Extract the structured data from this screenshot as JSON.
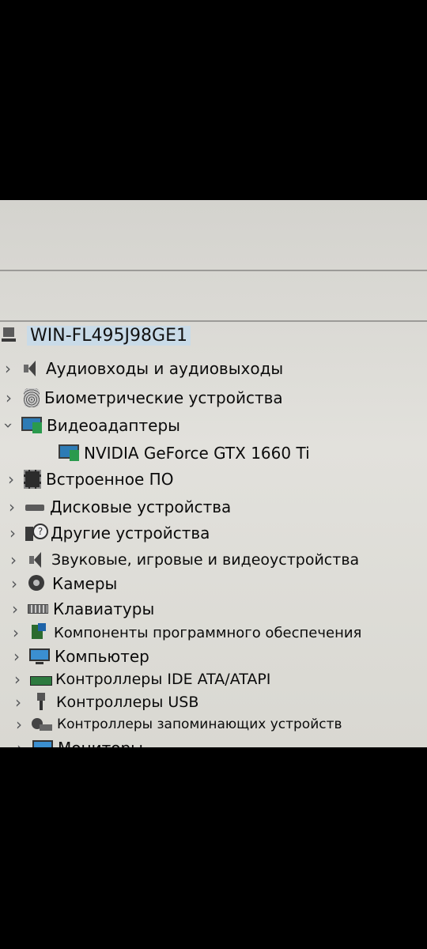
{
  "device_tree": {
    "root": {
      "label": "WIN-FL495J98GE1",
      "icon": "computer-icon"
    },
    "categories": [
      {
        "label": "Аудиовходы и аудиовыходы",
        "icon": "speaker-icon",
        "expanded": false
      },
      {
        "label": "Биометрические устройства",
        "icon": "fingerprint-icon",
        "expanded": false
      },
      {
        "label": "Видеоадаптеры",
        "icon": "display-adapter-icon",
        "expanded": true,
        "children": [
          {
            "label": "NVIDIA GeForce GTX 1660 Ti",
            "icon": "display-adapter-icon"
          }
        ]
      },
      {
        "label": "Встроенное ПО",
        "icon": "firmware-chip-icon",
        "expanded": false
      },
      {
        "label": "Дисковые устройства",
        "icon": "disk-drive-icon",
        "expanded": false
      },
      {
        "label": "Другие устройства",
        "icon": "unknown-device-icon",
        "expanded": false
      },
      {
        "label": "Звуковые, игровые и видеоустройства",
        "icon": "speaker-icon",
        "expanded": false
      },
      {
        "label": "Камеры",
        "icon": "camera-icon",
        "expanded": false
      },
      {
        "label": "Клавиатуры",
        "icon": "keyboard-icon",
        "expanded": false
      },
      {
        "label": "Компоненты программного обеспечения",
        "icon": "software-component-icon",
        "expanded": false
      },
      {
        "label": "Компьютер",
        "icon": "monitor-icon",
        "expanded": false
      },
      {
        "label": "Контроллеры IDE ATA/ATAPI",
        "icon": "ide-controller-icon",
        "expanded": false
      },
      {
        "label": "Контроллеры USB",
        "icon": "usb-icon",
        "expanded": false
      },
      {
        "label": "Контроллеры запоминающих устройств",
        "icon": "storage-controller-icon",
        "expanded": false
      },
      {
        "label": "Мониторы",
        "icon": "monitor-icon",
        "expanded": false
      }
    ]
  }
}
